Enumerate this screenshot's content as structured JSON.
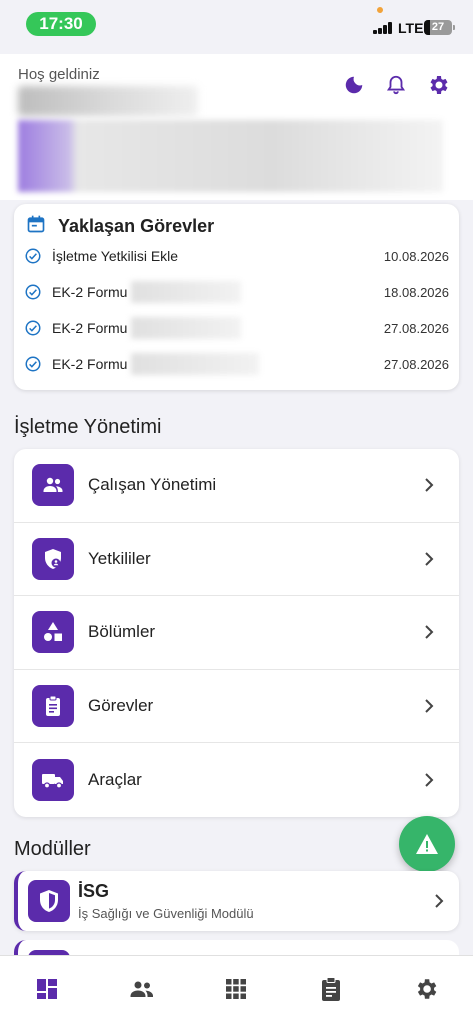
{
  "status_bar": {
    "time": "17:30",
    "network": "LTE",
    "battery": "27"
  },
  "header": {
    "welcome": "Hoş geldiniz",
    "icons": [
      "moon-icon",
      "bell-icon",
      "gear-icon"
    ]
  },
  "upcoming": {
    "title": "Yaklaşan Görevler",
    "tasks": [
      {
        "name": "İşletme Yetkilisi Ekle",
        "date": "10.08.2026"
      },
      {
        "name": "EK-2 Formu",
        "date": "18.08.2026"
      },
      {
        "name": "EK-2 Formu",
        "date": "27.08.2026"
      },
      {
        "name": "EK-2 Formu",
        "date": "27.08.2026"
      }
    ]
  },
  "management": {
    "title": "İşletme Yönetimi",
    "items": [
      {
        "label": "Çalışan Yönetimi",
        "icon": "people-icon"
      },
      {
        "label": "Yetkililer",
        "icon": "shield-user-icon"
      },
      {
        "label": "Bölümler",
        "icon": "shapes-icon"
      },
      {
        "label": "Görevler",
        "icon": "clipboard-icon"
      },
      {
        "label": "Araçlar",
        "icon": "truck-icon"
      }
    ]
  },
  "modules": {
    "title": "Modüller",
    "items": [
      {
        "title": "İSG",
        "subtitle": "İş Sağlığı ve Güvenliği Modülü",
        "icon": "shield-icon"
      }
    ]
  },
  "colors": {
    "primary": "#5b2bab",
    "fab": "#36b56a",
    "status_pill": "#35c759"
  },
  "tabs": [
    "dashboard-icon",
    "people-icon",
    "apps-grid-icon",
    "clipboard-icon",
    "gear-icon"
  ]
}
